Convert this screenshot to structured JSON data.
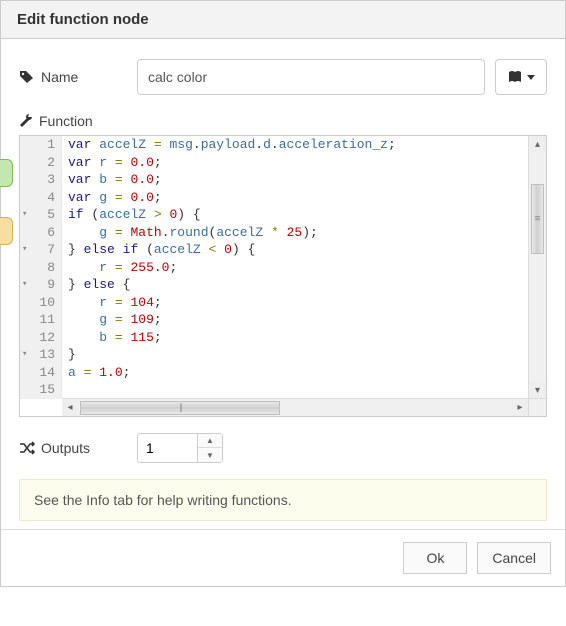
{
  "header": {
    "title": "Edit function node"
  },
  "name_row": {
    "label": "Name",
    "value": "calc color"
  },
  "function_row": {
    "label": "Function"
  },
  "code": {
    "lines": [
      {
        "n": 1,
        "fold": false,
        "html": "<span class='tok-kw'>var</span> <span class='tok-id'>accelZ</span> <span class='tok-op'>=</span> <span class='tok-id'>msg</span><span class='tok-pun'>.</span><span class='tok-id'>payload</span><span class='tok-pun'>.</span><span class='tok-id'>d</span><span class='tok-pun'>.</span><span class='tok-id'>acceleration_z</span><span class='tok-pun'>;</span>"
      },
      {
        "n": 2,
        "fold": false,
        "html": "<span class='tok-kw'>var</span> <span class='tok-id'>r</span> <span class='tok-op'>=</span> <span class='tok-num'>0.0</span><span class='tok-pun'>;</span>"
      },
      {
        "n": 3,
        "fold": false,
        "html": "<span class='tok-kw'>var</span> <span class='tok-id'>b</span> <span class='tok-op'>=</span> <span class='tok-num'>0.0</span><span class='tok-pun'>;</span>"
      },
      {
        "n": 4,
        "fold": false,
        "html": "<span class='tok-kw'>var</span> <span class='tok-id'>g</span> <span class='tok-op'>=</span> <span class='tok-num'>0.0</span><span class='tok-pun'>;</span>"
      },
      {
        "n": 5,
        "fold": true,
        "html": "<span class='tok-kw'>if</span> <span class='tok-pun'>(</span><span class='tok-id'>accelZ</span> <span class='tok-op'>&gt;</span> <span class='tok-num'>0</span><span class='tok-pun'>)</span> <span class='tok-pun'>{</span>"
      },
      {
        "n": 6,
        "fold": false,
        "html": "    <span class='tok-id'>g</span> <span class='tok-op'>=</span> <span class='tok-fn'>Math</span><span class='tok-pun'>.</span><span class='tok-id'>round</span><span class='tok-pun'>(</span><span class='tok-id'>accelZ</span> <span class='tok-op'>*</span> <span class='tok-num'>25</span><span class='tok-pun'>);</span>"
      },
      {
        "n": 7,
        "fold": true,
        "html": "<span class='tok-pun'>}</span> <span class='tok-kw'>else</span> <span class='tok-kw'>if</span> <span class='tok-pun'>(</span><span class='tok-id'>accelZ</span> <span class='tok-op'>&lt;</span> <span class='tok-num'>0</span><span class='tok-pun'>)</span> <span class='tok-pun'>{</span>"
      },
      {
        "n": 8,
        "fold": false,
        "html": "    <span class='tok-id'>r</span> <span class='tok-op'>=</span> <span class='tok-num'>255.0</span><span class='tok-pun'>;</span>"
      },
      {
        "n": 9,
        "fold": true,
        "html": "<span class='tok-pun'>}</span> <span class='tok-kw'>else</span> <span class='tok-pun'>{</span>"
      },
      {
        "n": 10,
        "fold": false,
        "html": "    <span class='tok-id'>r</span> <span class='tok-op'>=</span> <span class='tok-num'>104</span><span class='tok-pun'>;</span>"
      },
      {
        "n": 11,
        "fold": false,
        "html": "    <span class='tok-id'>g</span> <span class='tok-op'>=</span> <span class='tok-num'>109</span><span class='tok-pun'>;</span>"
      },
      {
        "n": 12,
        "fold": false,
        "html": "    <span class='tok-id'>b</span> <span class='tok-op'>=</span> <span class='tok-num'>115</span><span class='tok-pun'>;</span>"
      },
      {
        "n": 13,
        "fold": true,
        "html": "<span class='tok-pun'>}</span>"
      },
      {
        "n": 14,
        "fold": false,
        "html": "<span class='tok-id'>a</span> <span class='tok-op'>=</span> <span class='tok-num'>1.0</span><span class='tok-pun'>;</span>"
      },
      {
        "n": 15,
        "fold": false,
        "html": ""
      }
    ]
  },
  "outputs_row": {
    "label": "Outputs",
    "value": "1"
  },
  "info_tip": "See the Info tab for help writing functions.",
  "footer": {
    "ok": "Ok",
    "cancel": "Cancel"
  }
}
